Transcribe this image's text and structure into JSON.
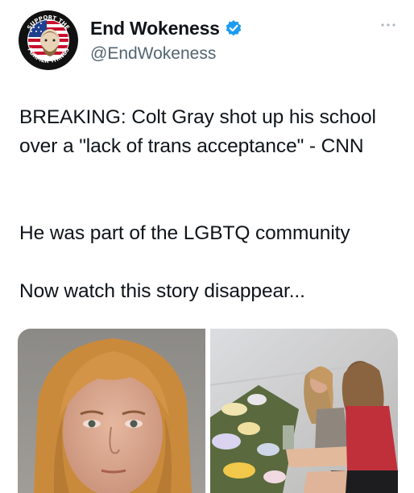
{
  "author": {
    "display_name": "End Wokeness",
    "handle": "@EndWokeness",
    "verified": true,
    "avatar_icon": "skull-flag-badge-icon",
    "avatar_ring_text_top": "SUPPORT THE",
    "avatar_ring_text_bottom": "FORMER THINGS"
  },
  "menu": {
    "icon": "more-options-icon"
  },
  "tweet": {
    "paragraphs": [
      "BREAKING: Colt Gray shot up his school over a \"lack of trans acceptance\" - CNN",
      "He was part of the LGBTQ community",
      "Now watch this story disappear..."
    ]
  },
  "media": [
    {
      "icon": "mugshot-photo"
    },
    {
      "icon": "memorial-vigil-photo"
    }
  ],
  "colors": {
    "text": "#0f1419",
    "secondary": "#536471",
    "verified_blue": "#1d9bf0"
  }
}
